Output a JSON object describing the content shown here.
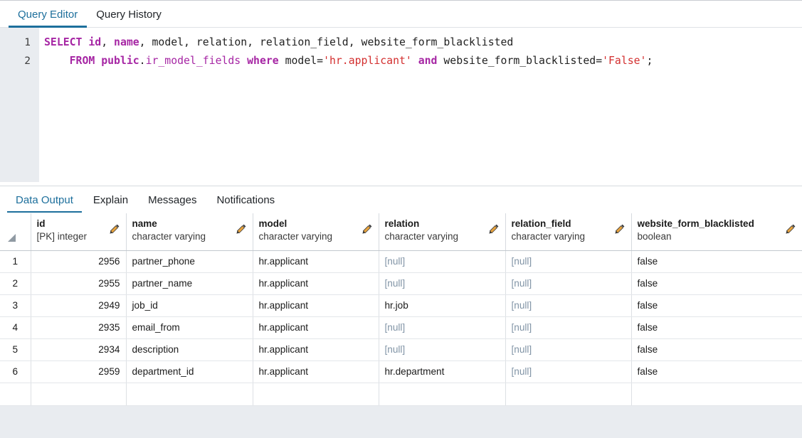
{
  "editor_tabs": [
    {
      "label": "Query Editor",
      "active": true
    },
    {
      "label": "Query History",
      "active": false
    }
  ],
  "query": {
    "line_numbers": [
      "1",
      "2"
    ],
    "text": "SELECT id, name, model, relation, relation_field, website_form_blacklisted\n    FROM public.ir_model_fields where model='hr.applicant' and website_form_blacklisted='False';",
    "line1": {
      "kw_select": "SELECT",
      "col_id": "id",
      "sep1": ", ",
      "col_name": "name",
      "sep2": ", ",
      "col_model": "model",
      "sep3": ", ",
      "col_relation": "relation",
      "sep4": ", ",
      "col_relation_field": "relation_field",
      "sep5": ", ",
      "col_wfb": "website_form_blacklisted"
    },
    "line2": {
      "indent": "    ",
      "kw_from": "FROM",
      "space1": " ",
      "schema": "public",
      "dot": ".",
      "table": "ir_model_fields",
      "space2": " ",
      "kw_where": "where",
      "space3": " ",
      "pred1_col": "model",
      "pred1_eq": "=",
      "pred1_val": "'hr.applicant'",
      "space4": " ",
      "kw_and": "and",
      "space5": " ",
      "pred2_col": "website_form_blacklisted",
      "pred2_eq": "=",
      "pred2_val": "'False'",
      "semi": ";"
    }
  },
  "result_tabs": [
    {
      "label": "Data Output",
      "active": true
    },
    {
      "label": "Explain",
      "active": false
    },
    {
      "label": "Messages",
      "active": false
    },
    {
      "label": "Notifications",
      "active": false
    }
  ],
  "grid": {
    "columns": [
      {
        "name": "id",
        "type": "[PK] integer"
      },
      {
        "name": "name",
        "type": "character varying"
      },
      {
        "name": "model",
        "type": "character varying"
      },
      {
        "name": "relation",
        "type": "character varying"
      },
      {
        "name": "relation_field",
        "type": "character varying"
      },
      {
        "name": "website_form_blacklisted",
        "type": "boolean"
      }
    ],
    "rows": [
      {
        "n": "1",
        "id": "2956",
        "name": "partner_phone",
        "model": "hr.applicant",
        "relation": "[null]",
        "relation_field": "[null]",
        "website_form_blacklisted": "false"
      },
      {
        "n": "2",
        "id": "2955",
        "name": "partner_name",
        "model": "hr.applicant",
        "relation": "[null]",
        "relation_field": "[null]",
        "website_form_blacklisted": "false"
      },
      {
        "n": "3",
        "id": "2949",
        "name": "job_id",
        "model": "hr.applicant",
        "relation": "hr.job",
        "relation_field": "[null]",
        "website_form_blacklisted": "false"
      },
      {
        "n": "4",
        "id": "2935",
        "name": "email_from",
        "model": "hr.applicant",
        "relation": "[null]",
        "relation_field": "[null]",
        "website_form_blacklisted": "false"
      },
      {
        "n": "5",
        "id": "2934",
        "name": "description",
        "model": "hr.applicant",
        "relation": "[null]",
        "relation_field": "[null]",
        "website_form_blacklisted": "false"
      },
      {
        "n": "6",
        "id": "2959",
        "name": "department_id",
        "model": "hr.applicant",
        "relation": "hr.department",
        "relation_field": "[null]",
        "website_form_blacklisted": "false"
      }
    ],
    "null_token": "[null]"
  },
  "colors": {
    "accent": "#1d6f9c",
    "gutter_bg": "#e9ecf0",
    "keyword": "#a626a4",
    "string": "#d32f2f",
    "null_text": "#8194a6"
  }
}
